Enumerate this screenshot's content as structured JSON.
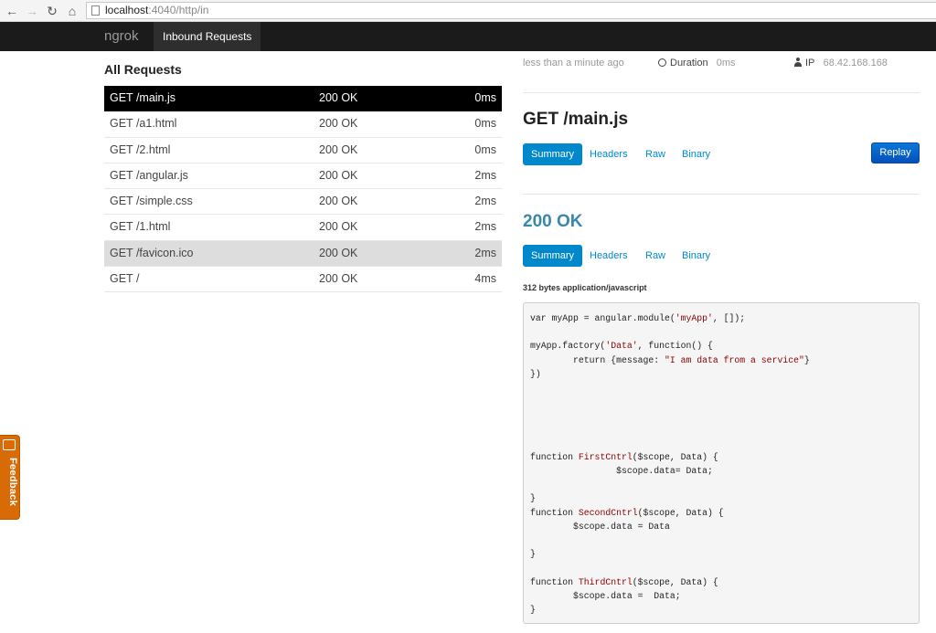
{
  "browser": {
    "url_host": "localhost",
    "url_path": ":4040/http/in"
  },
  "navbar": {
    "brand": "ngrok",
    "tab": "Inbound Requests"
  },
  "requests": {
    "title": "All Requests",
    "rows": [
      {
        "path": "GET /main.js",
        "status": "200 OK",
        "duration": "0ms"
      },
      {
        "path": "GET /a1.html",
        "status": "200 OK",
        "duration": "0ms"
      },
      {
        "path": "GET /2.html",
        "status": "200 OK",
        "duration": "0ms"
      },
      {
        "path": "GET /angular.js",
        "status": "200 OK",
        "duration": "2ms"
      },
      {
        "path": "GET /simple.css",
        "status": "200 OK",
        "duration": "2ms"
      },
      {
        "path": "GET /1.html",
        "status": "200 OK",
        "duration": "2ms"
      },
      {
        "path": "GET /favicon.ico",
        "status": "200 OK",
        "duration": "2ms"
      },
      {
        "path": "GET /",
        "status": "200 OK",
        "duration": "4ms"
      }
    ]
  },
  "detail": {
    "time": "less than a minute ago",
    "duration_label": "Duration",
    "duration_value": "0ms",
    "ip_label": "IP",
    "ip_value": "68.42.168.168",
    "request_title": "GET /main.js",
    "response_title": "200 OK",
    "tabs": [
      "Summary",
      "Headers",
      "Raw",
      "Binary"
    ],
    "replay_label": "Replay",
    "bytes_info": "312 bytes application/javascript",
    "code_lines": [
      "var myApp = angular.module('myApp', []);",
      "",
      "myApp.factory('Data', function() {",
      "        return {message: \"I am data from a service\"}",
      "})",
      "",
      "",
      "",
      "",
      "",
      "function FirstCntrl($scope, Data) {",
      "                $scope.data= Data;",
      "",
      "}",
      "function SecondCntrl($scope, Data) {",
      "        $scope.data = Data",
      "",
      "}",
      "",
      "function ThirdCntrl($scope, Data) {",
      "        $scope.data =  Data;",
      "}"
    ]
  },
  "feedback": {
    "label": "Feedback"
  }
}
